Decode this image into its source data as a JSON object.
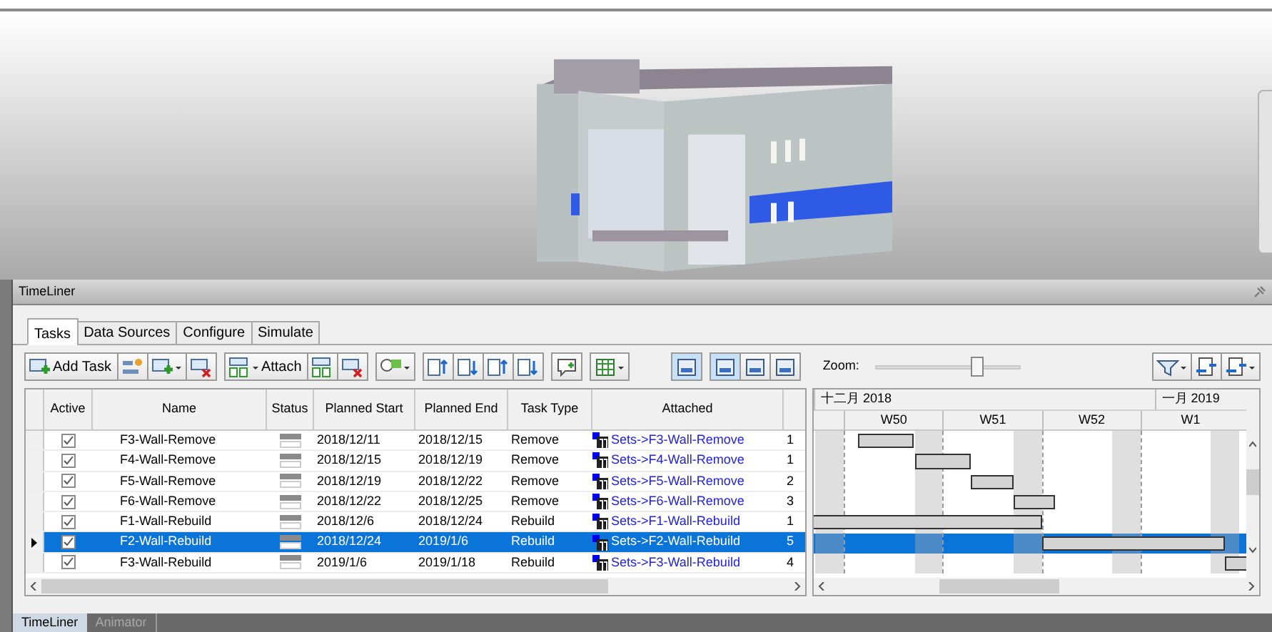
{
  "panel": {
    "title": "TimeLiner"
  },
  "tabs": [
    {
      "label": "Tasks",
      "selected": true
    },
    {
      "label": "Data Sources",
      "selected": false
    },
    {
      "label": "Configure",
      "selected": false
    },
    {
      "label": "Simulate",
      "selected": false
    }
  ],
  "toolbar": {
    "add_task": "Add Task",
    "attach": "Attach",
    "view_buttons": [
      {
        "selected": true
      },
      {
        "selected": true
      },
      {
        "selected": false
      },
      {
        "selected": false
      }
    ],
    "zoom": {
      "label": "Zoom:",
      "level": 0.7
    }
  },
  "table": {
    "columns": [
      "Active",
      "Name",
      "Status",
      "Planned Start",
      "Planned End",
      "Task Type",
      "Attached"
    ],
    "rows": [
      {
        "active": true,
        "name": "F3-Wall-Remove",
        "planned_start": "2018/12/11",
        "planned_end": "2018/12/15",
        "task_type": "Remove",
        "attached": "Sets->F3-Wall-Remove",
        "column_9": "1",
        "selected": false
      },
      {
        "active": true,
        "name": "F4-Wall-Remove",
        "planned_start": "2018/12/15",
        "planned_end": "2018/12/19",
        "task_type": "Remove",
        "attached": "Sets->F4-Wall-Remove",
        "column_9": "1",
        "selected": false
      },
      {
        "active": true,
        "name": "F5-Wall-Remove",
        "planned_start": "2018/12/19",
        "planned_end": "2018/12/22",
        "task_type": "Remove",
        "attached": "Sets->F5-Wall-Remove",
        "column_9": "2",
        "selected": false
      },
      {
        "active": true,
        "name": "F6-Wall-Remove",
        "planned_start": "2018/12/22",
        "planned_end": "2018/12/25",
        "task_type": "Remove",
        "attached": "Sets->F6-Wall-Remove",
        "column_9": "3",
        "selected": false
      },
      {
        "active": true,
        "name": "F1-Wall-Rebuild",
        "planned_start": "2018/12/6",
        "planned_end": "2018/12/24",
        "task_type": "Rebuild",
        "attached": "Sets->F1-Wall-Rebuild",
        "column_9": "1",
        "selected": false
      },
      {
        "active": true,
        "name": "F2-Wall-Rebuild",
        "planned_start": "2018/12/24",
        "planned_end": "2019/1/6",
        "task_type": "Rebuild",
        "attached": "Sets->F2-Wall-Rebuild",
        "column_9": "5",
        "selected": true
      },
      {
        "active": true,
        "name": "F3-Wall-Rebuild",
        "planned_start": "2019/1/6",
        "planned_end": "2019/1/18",
        "task_type": "Rebuild",
        "attached": "Sets->F3-Wall-Rebuild",
        "column_9": "4",
        "selected": false
      }
    ]
  },
  "gantt": {
    "months": [
      "十二月 2018",
      "一月 2019"
    ],
    "weeks": [
      "W50",
      "W51",
      "W52",
      "W1"
    ]
  },
  "bottom_tabs": [
    {
      "label": "TimeLiner",
      "selected": true
    },
    {
      "label": "Animator",
      "selected": false
    }
  ]
}
